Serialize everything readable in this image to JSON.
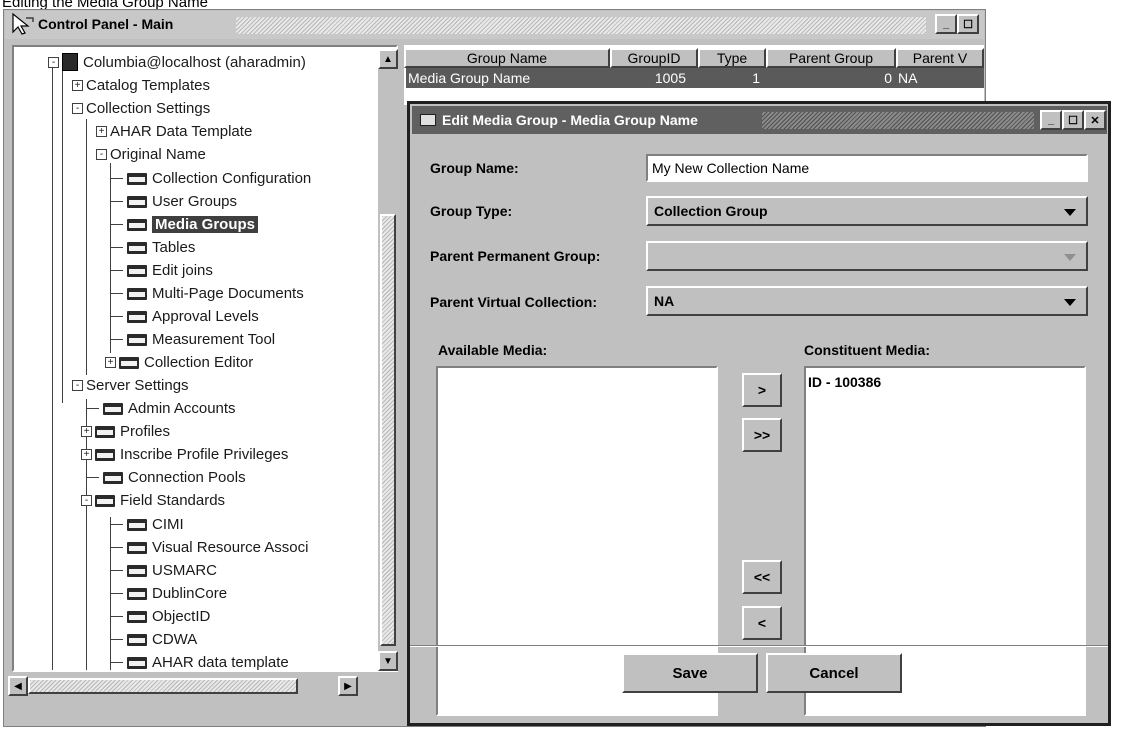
{
  "top_caption": "Editing the Media Group Name",
  "main_window": {
    "title": "Control Panel - Main",
    "min_label": "_",
    "max_label": "☐"
  },
  "tree": {
    "root": "Columbia@localhost (aharadmin)",
    "items": [
      {
        "label": "Catalog Templates"
      },
      {
        "label": "Collection Settings"
      },
      {
        "label": "AHAR Data Template"
      },
      {
        "label": "Original Name"
      },
      {
        "label": "Collection Configuration"
      },
      {
        "label": "User Groups"
      },
      {
        "label": "Media Groups"
      },
      {
        "label": "Tables"
      },
      {
        "label": "Edit joins"
      },
      {
        "label": "Multi-Page Documents"
      },
      {
        "label": "Approval Levels"
      },
      {
        "label": "Measurement Tool"
      },
      {
        "label": "Collection Editor"
      },
      {
        "label": "Server Settings"
      },
      {
        "label": "Admin Accounts"
      },
      {
        "label": "Profiles"
      },
      {
        "label": "Inscribe Profile Privileges"
      },
      {
        "label": "Connection Pools"
      },
      {
        "label": "Field Standards"
      },
      {
        "label": "CIMI"
      },
      {
        "label": "Visual Resource Associ"
      },
      {
        "label": "USMARC"
      },
      {
        "label": "DublinCore"
      },
      {
        "label": "ObjectID"
      },
      {
        "label": "CDWA"
      },
      {
        "label": "AHAR data template"
      }
    ]
  },
  "group_table": {
    "columns": [
      "Group Name",
      "GroupID",
      "Type",
      "Parent Group",
      "Parent V"
    ],
    "row": [
      "Media Group Name",
      "1005",
      "1",
      "0",
      "NA"
    ]
  },
  "dialog": {
    "title": "Edit Media Group - Media Group Name",
    "group_name_label": "Group Name:",
    "group_name_value": "My New Collection Name",
    "group_type_label": "Group Type:",
    "group_type_value": "Collection Group",
    "parent_permanent_label": "Parent Permanent Group:",
    "parent_permanent_value": "",
    "parent_virtual_label": "Parent Virtual Collection:",
    "parent_virtual_value": "NA",
    "available_media_label": "Available Media:",
    "constituent_media_label": "Constituent Media:",
    "constituent_items": [
      "ID - 100386"
    ],
    "add_one": ">",
    "add_all": ">>",
    "remove_all": "<<",
    "remove_one": "<",
    "save": "Save",
    "cancel": "Cancel"
  }
}
